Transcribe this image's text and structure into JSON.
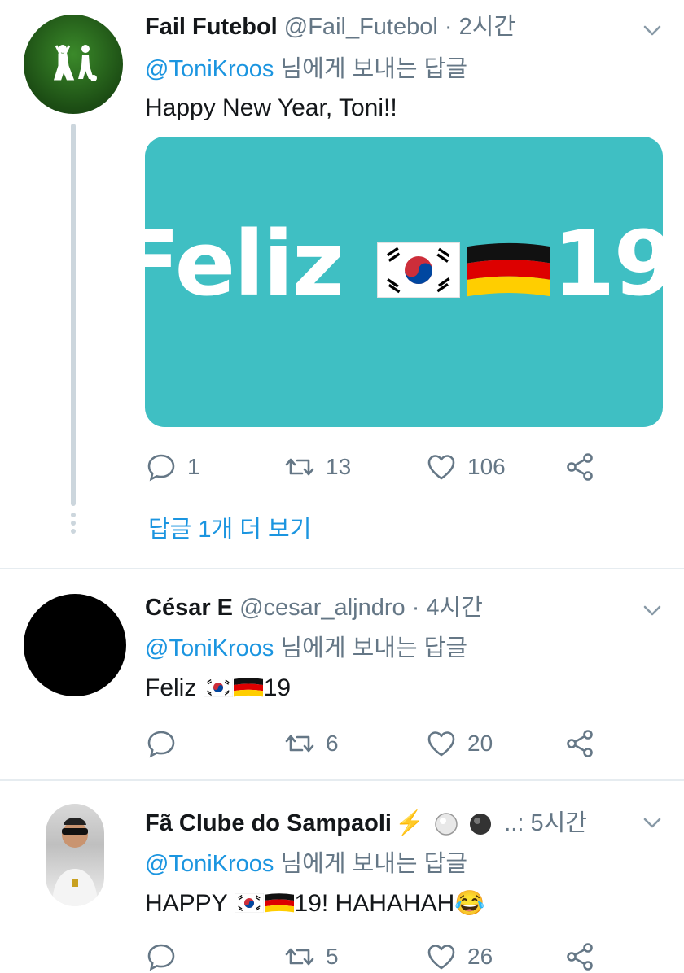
{
  "tweets": [
    {
      "name": "Fail Futebol",
      "handle": "@Fail_Futebol",
      "time": "2시간",
      "reply_mention": "@ToniKroos",
      "reply_suffix": "님에게 보내는 답글",
      "text": "Happy New Year, Toni!!",
      "media_text_before": "Feliz",
      "media_text_after": "19",
      "replies": "1",
      "retweets": "13",
      "likes": "106",
      "show_more": "답글 1개 더 보기"
    },
    {
      "name": "César E",
      "handle": "@cesar_aljndro",
      "time": "4시간",
      "reply_mention": "@ToniKroos",
      "reply_suffix": "님에게 보내는 답글",
      "text_before": "Feliz",
      "text_after": "19",
      "replies": "",
      "retweets": "6",
      "likes": "20"
    },
    {
      "name": "Fã Clube do Sampaoli",
      "name_emoji": "⚡",
      "handle_truncated": "..:",
      "time": "5시간",
      "reply_mention": "@ToniKroos",
      "reply_suffix": "님에게 보내는 답글",
      "text_before": "HAPPY",
      "text_after": "19! HAHAHAH",
      "text_emoji": "😂",
      "replies": "",
      "retweets": "5",
      "likes": "26"
    }
  ],
  "colors": {
    "link": "#1b95e0",
    "muted": "#657786",
    "media_bg": "#3fbfc3",
    "divider": "#e6ecf0"
  },
  "icons": [
    "reply-icon",
    "retweet-icon",
    "like-icon",
    "share-icon",
    "chevron-down-icon",
    "korea-flag-icon",
    "germany-flag-icon"
  ]
}
